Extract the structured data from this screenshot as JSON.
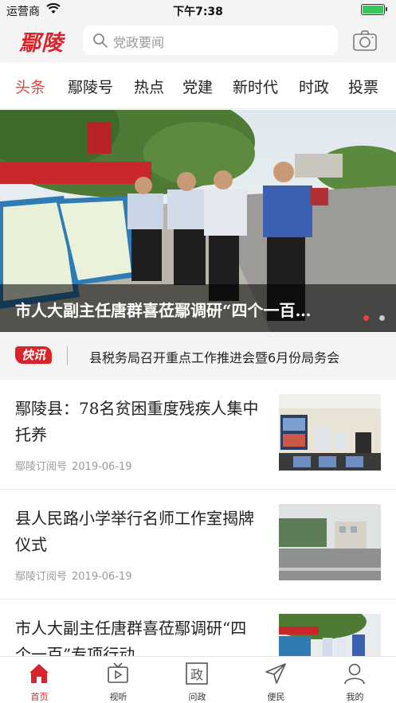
{
  "status_bar": {
    "carrier": "运营商",
    "time": "下午7:38"
  },
  "header": {
    "logo": "鄢陵",
    "search_placeholder": "党政要闻",
    "search_icon": "search-icon",
    "camera_icon": "camera-icon"
  },
  "tabs": [
    {
      "label": "头条",
      "active": true
    },
    {
      "label": "鄢陵号",
      "active": false
    },
    {
      "label": "热点",
      "active": false
    },
    {
      "label": "党建",
      "active": false
    },
    {
      "label": "新时代",
      "active": false
    },
    {
      "label": "时政",
      "active": false
    },
    {
      "label": "投票",
      "active": false
    }
  ],
  "hero": {
    "caption": "市人大副主任唐群喜莅鄢调研“四个一百…",
    "slide_count": 2,
    "active_slide": 1
  },
  "flash": {
    "badge": "快讯",
    "text": "县税务局召开重点工作推进会暨6月份局务会"
  },
  "news": [
    {
      "title": "鄢陵县：78名贫困重度残疾人集中托养",
      "source": "鄢陵订阅号",
      "date": "2019-06-19"
    },
    {
      "title": "县人民路小学举行名师工作室揭牌仪式",
      "source": "鄢陵订阅号",
      "date": "2019-06-19"
    },
    {
      "title": "市人大副主任唐群喜莅鄢调研“四个一百”专项行动",
      "source": "",
      "date": ""
    }
  ],
  "bottom_nav": [
    {
      "label": "首页",
      "icon": "home-icon",
      "active": true
    },
    {
      "label": "视听",
      "icon": "tv-icon",
      "active": false
    },
    {
      "label": "问政",
      "icon": "zheng-icon",
      "active": false
    },
    {
      "label": "便民",
      "icon": "send-icon",
      "active": false
    },
    {
      "label": "我的",
      "icon": "user-icon",
      "active": false
    }
  ],
  "colors": {
    "brand_red": "#d8242b",
    "active_tab": "#e2453c",
    "battery_green": "#35c759",
    "meta_gray": "#9a9a9a"
  }
}
